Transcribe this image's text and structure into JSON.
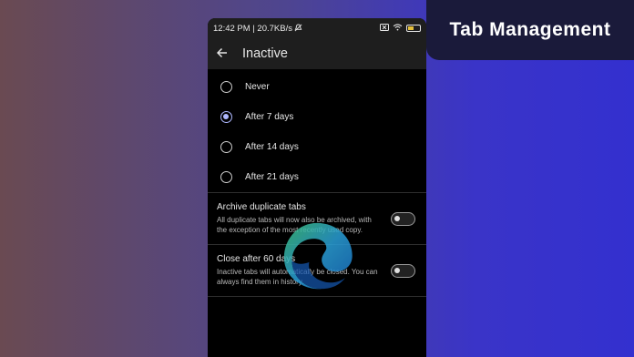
{
  "status_bar": {
    "time_network": "12:42 PM | 20.7KB/s",
    "mute_icon": "bell-off-icon",
    "sim_icon": "sim-icon",
    "wifi_icon": "wifi-icon",
    "battery_icon": "battery-icon"
  },
  "toolbar": {
    "back_icon": "arrow-left-icon",
    "title": "Inactive"
  },
  "options": [
    {
      "label": "Never",
      "selected": false
    },
    {
      "label": "After 7 days",
      "selected": true
    },
    {
      "label": "After 14 days",
      "selected": false
    },
    {
      "label": "After 21 days",
      "selected": false
    }
  ],
  "settings": {
    "archive": {
      "title": "Archive duplicate tabs",
      "description": "All duplicate tabs will now also be archived, with the exception of the most recently used copy.",
      "enabled": false
    },
    "close": {
      "title": "Close after 60 days",
      "description": "Inactive tabs will automatically be closed. You can always find them in history.",
      "enabled": false
    }
  },
  "banner": {
    "text": "Tab Management"
  },
  "colors": {
    "accent": "#aeb8ff",
    "banner_bg": "#1a1a3a"
  }
}
